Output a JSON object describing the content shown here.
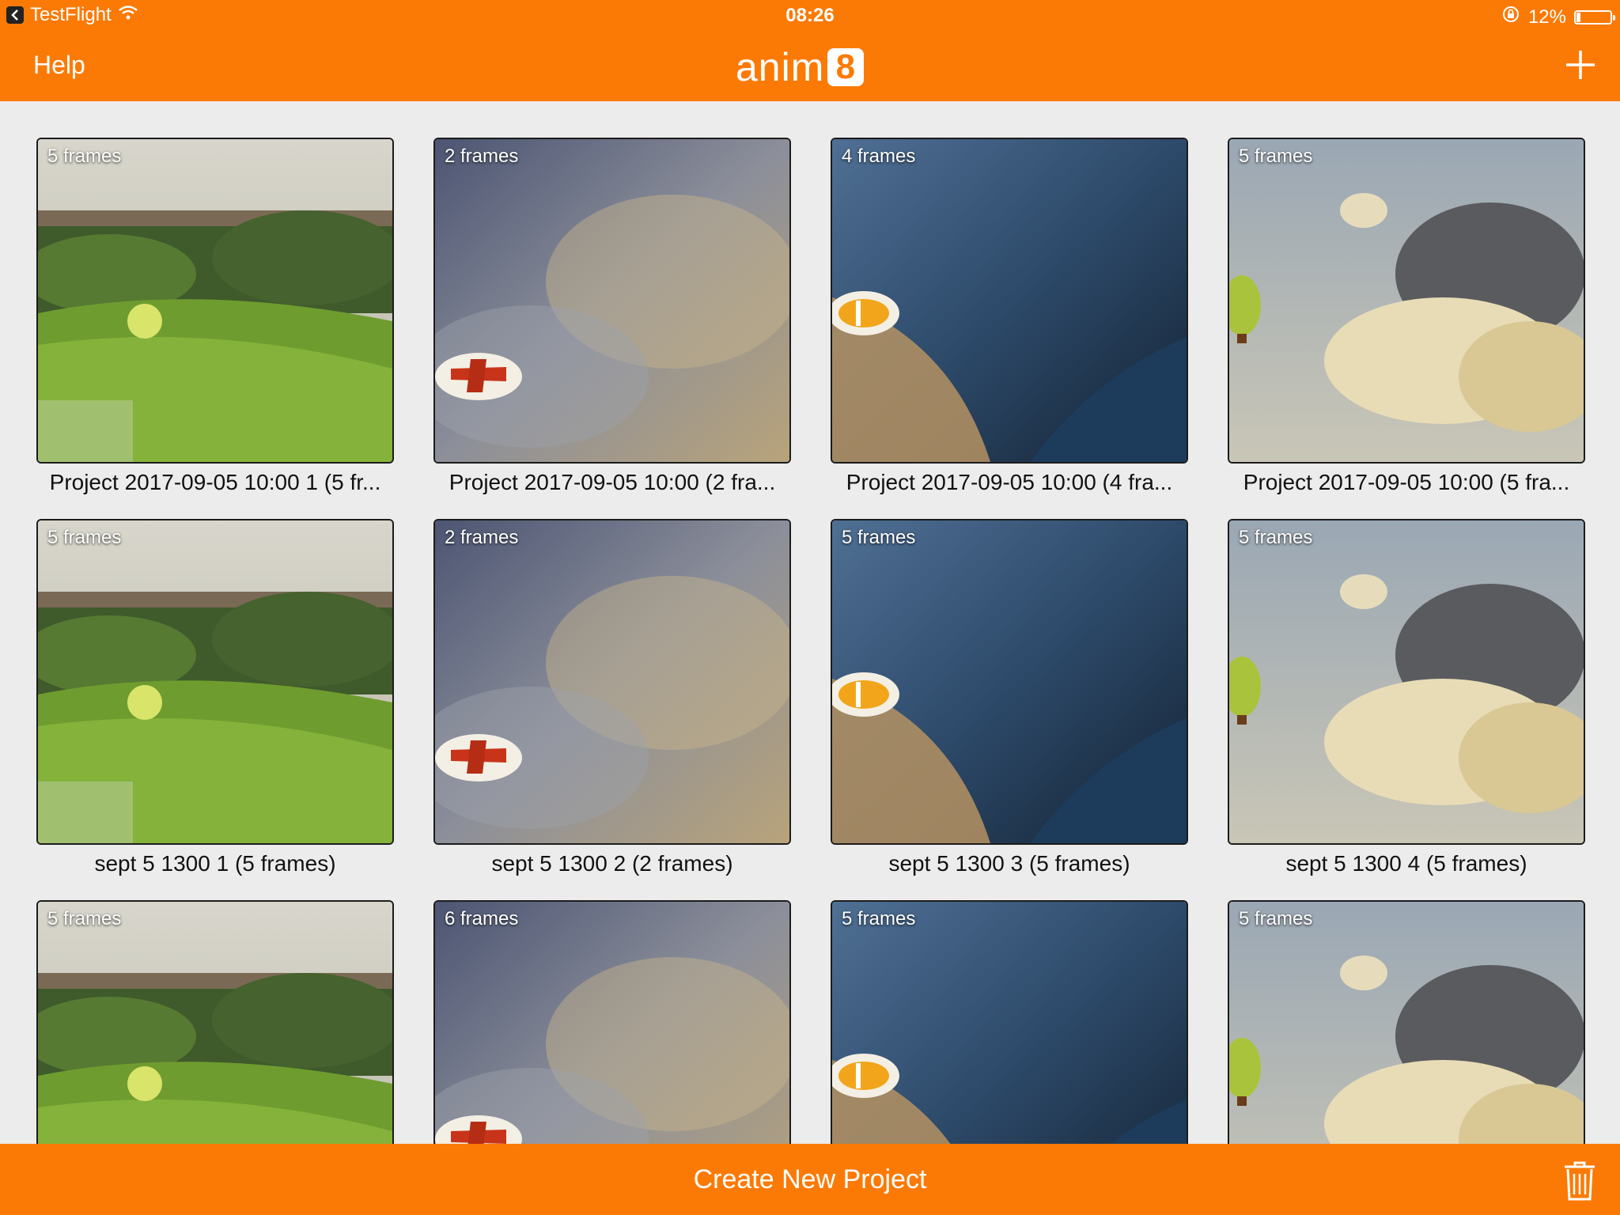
{
  "status_bar": {
    "back_app": "TestFlight",
    "time": "08:26",
    "battery_percent": "12%",
    "battery_level": 0.12
  },
  "nav": {
    "help_label": "Help",
    "logo_text": "anim",
    "logo_badge": "8",
    "add_icon": "plus-icon"
  },
  "projects": [
    {
      "frames_label": "5 frames",
      "title": "Project 2017-09-05 10:00 1 (5 fr...",
      "scene": "garden"
    },
    {
      "frames_label": "2 frames",
      "title": "Project 2017-09-05 10:00 (2 fra...",
      "scene": "plane"
    },
    {
      "frames_label": "4 frames",
      "title": "Project 2017-09-05 10:00 (4 fra...",
      "scene": "fish"
    },
    {
      "frames_label": "5 frames",
      "title": "Project 2017-09-05 10:00 (5 fra...",
      "scene": "balloon"
    },
    {
      "frames_label": "5 frames",
      "title": "sept 5 1300 1 (5 frames)",
      "scene": "garden"
    },
    {
      "frames_label": "2 frames",
      "title": "sept 5 1300 2 (2 frames)",
      "scene": "plane"
    },
    {
      "frames_label": "5 frames",
      "title": "sept 5 1300 3 (5 frames)",
      "scene": "fish"
    },
    {
      "frames_label": "5 frames",
      "title": "sept 5 1300 4 (5 frames)",
      "scene": "balloon"
    },
    {
      "frames_label": "5 frames",
      "title": "",
      "scene": "garden"
    },
    {
      "frames_label": "6 frames",
      "title": "",
      "scene": "plane"
    },
    {
      "frames_label": "5 frames",
      "title": "",
      "scene": "fish"
    },
    {
      "frames_label": "5 frames",
      "title": "",
      "scene": "balloon"
    }
  ],
  "bottom_bar": {
    "create_label": "Create New Project",
    "trash_icon": "trash-icon"
  },
  "colors": {
    "accent": "#fb7a05",
    "background": "#ececec"
  }
}
